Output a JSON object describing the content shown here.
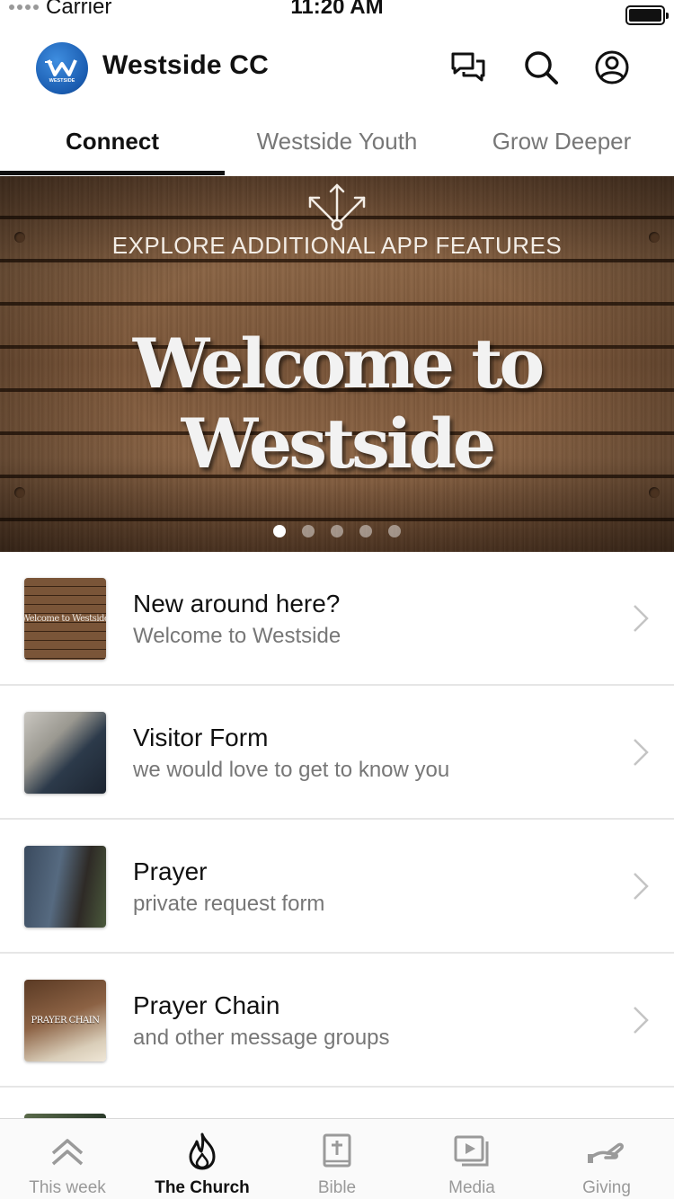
{
  "status_bar": {
    "carrier": "Carrier",
    "time": "11:20 AM",
    "battery_level": 1.0
  },
  "header": {
    "app_title": "Westside CC",
    "logo_text": "WESTSIDE",
    "icons": [
      "chat-icon",
      "search-icon",
      "profile-icon"
    ]
  },
  "tabs": [
    {
      "label": "Connect",
      "active": true
    },
    {
      "label": "Westside Youth",
      "active": false
    },
    {
      "label": "Grow Deeper",
      "active": false
    }
  ],
  "banner": {
    "explore_text": "EXPLORE ADDITIONAL APP FEATURES",
    "welcome_text": "Welcome to Westside",
    "page_count": 5,
    "active_page": 1
  },
  "list": {
    "items": [
      {
        "title": "New around here?",
        "subtitle": "Welcome to Westside",
        "thumb_text": "Welcome to Westside"
      },
      {
        "title": "Visitor Form",
        "subtitle": "we would love to get to know you"
      },
      {
        "title": "Prayer",
        "subtitle": "private request form"
      },
      {
        "title": "Prayer Chain",
        "subtitle": "and other message groups",
        "thumb_text": "PRAYER CHAIN"
      }
    ]
  },
  "bottom_nav": [
    {
      "label": "This week",
      "icon": "chevrons-up-icon",
      "active": false
    },
    {
      "label": "The Church",
      "icon": "flame-icon",
      "active": true
    },
    {
      "label": "Bible",
      "icon": "bible-icon",
      "active": false
    },
    {
      "label": "Media",
      "icon": "media-icon",
      "active": false
    },
    {
      "label": "Giving",
      "icon": "giving-icon",
      "active": false
    }
  ],
  "colors": {
    "accent": "#111111",
    "inactive": "#999999",
    "logo_blue": "#1a5cb0"
  }
}
